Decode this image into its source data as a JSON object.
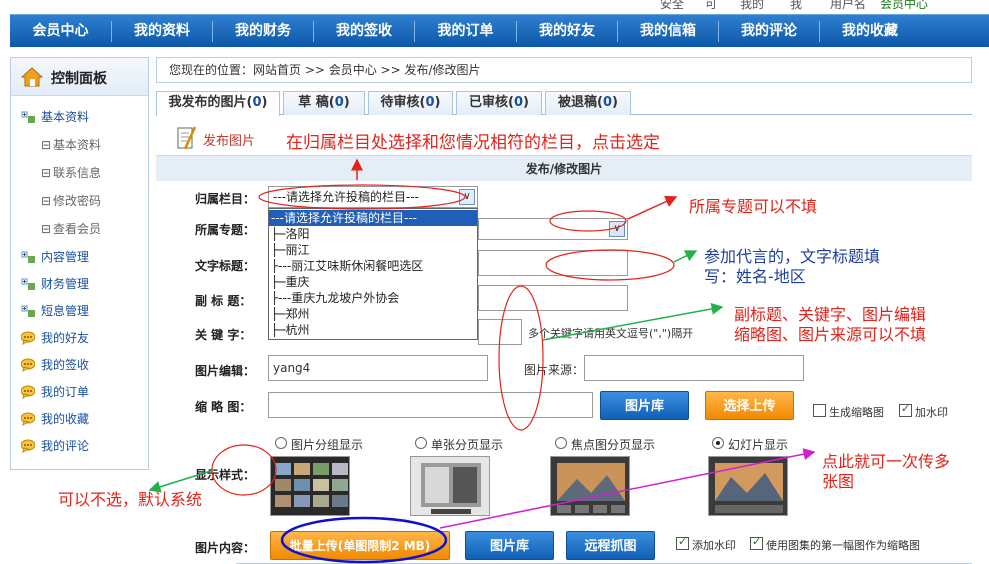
{
  "topbar": {
    "fragment1": "安全",
    "fragment2": "可",
    "fragment3": "我的",
    "fragment4": "我",
    "fragment5": "用户名",
    "fragment6": "会员中心"
  },
  "nav": {
    "items": [
      "会员中心",
      "我的资料",
      "我的财务",
      "我的签收",
      "我的订单",
      "我的好友",
      "我的信箱",
      "我的评论",
      "我的收藏"
    ]
  },
  "sidebar": {
    "title": "控制面板",
    "items": [
      {
        "label": "基本资料",
        "type": "group"
      },
      {
        "label": "基本资料",
        "type": "sub"
      },
      {
        "label": "联系信息",
        "type": "sub"
      },
      {
        "label": "修改密码",
        "type": "sub"
      },
      {
        "label": "查看会员",
        "type": "sub"
      },
      {
        "label": "内容管理",
        "type": "group"
      },
      {
        "label": "财务管理",
        "type": "group"
      },
      {
        "label": "短息管理",
        "type": "group"
      },
      {
        "label": "我的好友",
        "type": "chat"
      },
      {
        "label": "我的签收",
        "type": "chat"
      },
      {
        "label": "我的订单",
        "type": "chat"
      },
      {
        "label": "我的收藏",
        "type": "chat"
      },
      {
        "label": "我的评论",
        "type": "chat"
      }
    ]
  },
  "breadcrumb": {
    "text": "您现在的位置：网站首页 >> 会员中心 >> 发布/修改图片"
  },
  "tabs": [
    {
      "label": "我发布的图片",
      "count": "0"
    },
    {
      "label": "草 稿",
      "count": "0"
    },
    {
      "label": "待审核",
      "count": "0"
    },
    {
      "label": "已审核",
      "count": "0"
    },
    {
      "label": "被退稿",
      "count": "0"
    }
  ],
  "publish_link": "发布图片",
  "section_title": "发布/修改图片",
  "form": {
    "category_label": "归属栏目：",
    "category_value": "---请选择允许投稿的栏目---",
    "category_options": [
      "---请选择允许投稿的栏目---",
      "├─洛阳",
      "├─丽江",
      "├---丽江艾味斯休闲餐吧选区",
      "├─重庆",
      "├---重庆九龙坡户外协会",
      "├─郑州",
      "├─杭州"
    ],
    "topic_label": "所属专题：",
    "title_label": "文字标题：",
    "subtitle_label": "副 标 题：",
    "keywords_label": "关 键 字：",
    "keywords_hint": "多个关键字请用英文逗号(\",\")隔开",
    "editor_label": "图片编辑：",
    "editor_value": "yang4",
    "source_label": "图片来源：",
    "thumb_label": "缩 略 图：",
    "gallery_button": "图片库",
    "upload_button": "选择上传",
    "make_thumb_label": "生成缩略图",
    "watermark_label": "加水印",
    "style_label": "显示样式：",
    "style_options": [
      {
        "label": "图片分组显示",
        "selected": false
      },
      {
        "label": "单张分页显示",
        "selected": false
      },
      {
        "label": "焦点图分页显示",
        "selected": false
      },
      {
        "label": "幻灯片显示",
        "selected": true
      }
    ],
    "content_label": "图片内容：",
    "batch_upload_button": "批量上传(单图限制2 MB)",
    "gallery_button2": "图片库",
    "remote_button": "远程抓图",
    "add_watermark_label": "添加水印",
    "use_first_label": "使用图集的第一幅图作为缩略图"
  },
  "annotations": {
    "a1": "在归属栏目处选择和您情况相符的栏目，点击选定",
    "a2": "所属专题可以不填",
    "a3_line1": "参加代言的，文字标题填",
    "a3_line2": "写：姓名-地区",
    "a4_line1": "副标题、关键字、图片编辑",
    "a4_line2": "缩略图、图片来源可以不填",
    "a5_line1": "点此就可一次传多",
    "a5_line2": "张图",
    "a6": "可以不选，默认系统"
  },
  "colors": {
    "nav_blue": "#0d58a8",
    "annotation_red": "#e2231a",
    "annotation_blue": "#1d3f9e",
    "orange_button": "#f08a00"
  }
}
